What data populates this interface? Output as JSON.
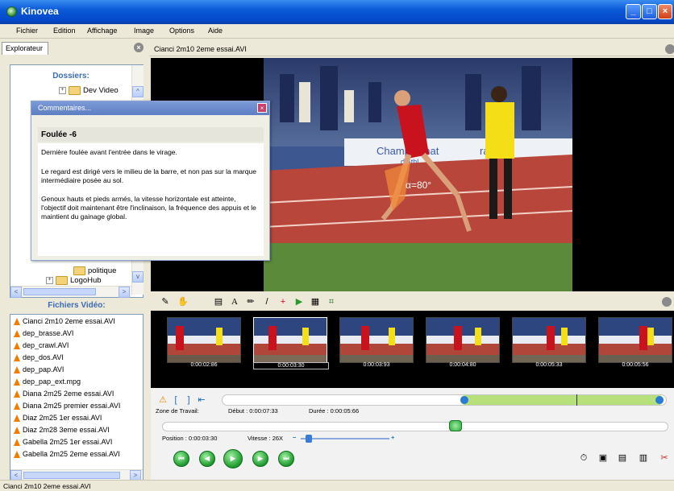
{
  "window": {
    "title": "Kinovea"
  },
  "menu": [
    "Fichier",
    "Edition",
    "Affichage",
    "Image",
    "Options",
    "Aide"
  ],
  "explorer": {
    "tab_label": "Explorateur",
    "folders_title": "Dossiers:",
    "tree": [
      "Dev Video",
      "politique",
      "LogoHub"
    ],
    "videos_title": "Fichiers Vidéo:",
    "files": [
      "Cianci 2m10 2eme essai.AVI",
      "dep_brasse.AVI",
      "dep_crawl.AVI",
      "dep_dos.AVI",
      "dep_pap.AVI",
      "dep_pap_ext.mpg",
      "Diana 2m25 2eme essai.AVI",
      "Diana 2m25 premier essai.AVI",
      "Diaz 2m25 1er essai.AVI",
      "Diaz 2m28 3eme essai.AVI",
      "Gabella 2m25 1er essai.AVI",
      "Gabella 2m25 2eme essai.AVI"
    ]
  },
  "comment_dialog": {
    "title": "Commentaires...",
    "heading": "Foulée -6",
    "paragraphs": [
      "Dernière foulée avant l'entrée dans le virage.",
      "Le regard est dirigé vers le milieu de la barre, et non pas sur la marque intermédiaire posée au sol.",
      "Genoux hauts et pieds armés, la vitesse horizontale est atteinte, l'objectif doit maintenant être l'inclinaison, la fréquence des appuis et le maintient du gainage global."
    ]
  },
  "player": {
    "file_title": "Cianci 2m10 2eme essai.AVI",
    "angle_label": "α=80°",
    "banner_text_1": "Championnat",
    "banner_text_2": "rance",
    "banner_text_3": "d'Athl",
    "thumbnails": [
      "0:00:02:86",
      "0:00:03:30",
      "0:00:03:93",
      "0:00:04:80",
      "0:00:05:33",
      "0:00:05:56"
    ],
    "selected_thumbnail": 1,
    "work_zone_label": "Zone de Travail:",
    "start_label": "Début : 0:00:07:33",
    "duration_label": "Durée : 0:00:05:66",
    "position_label": "Position : 0:00:03:30",
    "speed_label": "Vitesse : 26X",
    "speed_minus": "−",
    "speed_plus": "+"
  },
  "status": {
    "text": "Cianci 2m10 2eme essai.AVI"
  },
  "colors": {
    "accent": "#3b6bb5",
    "titlebar": "#0a5ad8",
    "green": "#b6e07a"
  }
}
